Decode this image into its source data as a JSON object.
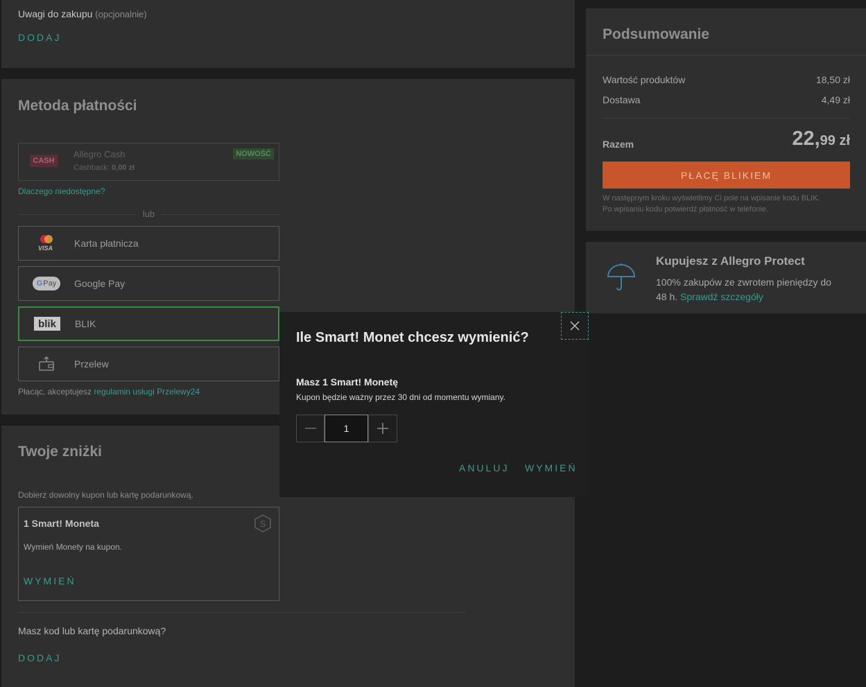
{
  "notes": {
    "title": "Uwagi do zakupu",
    "optional": "(opcjonalnie)",
    "add": "DODAJ"
  },
  "payment": {
    "title": "Metoda płatności",
    "cash": {
      "badge": "CASH",
      "name": "Allegro Cash",
      "cashback_label": "Cashback:",
      "cashback_value": "0,00 zł",
      "new_badge": "NOWOŚĆ"
    },
    "why_unavailable": "Dlaczego niedostępne?",
    "or": "lub",
    "options": [
      {
        "label": "Karta płatnicza",
        "icon": "card-icon"
      },
      {
        "label": "Google Pay",
        "icon": "google-pay-icon"
      },
      {
        "label": "BLIK",
        "icon": "blik-icon"
      },
      {
        "label": "Przelew",
        "icon": "wallet-icon"
      }
    ],
    "visa_text": "VISA",
    "gpay_text": "Pay",
    "blik_text": "blik",
    "terms_prefix": "Płacąc, akceptujesz",
    "terms_link": "regulamin usługi Przelewy24"
  },
  "discounts": {
    "title": "Twoje zniżki",
    "hint": "Dobierz dowolny kupon lub kartę podarunkową.",
    "coin_card": {
      "title": "1 Smart! Moneta",
      "desc": "Wymień Monety na kupon.",
      "action": "WYMIEŃ",
      "icon_letter": "S"
    },
    "code_question": "Masz kod lub kartę podarunkową?",
    "add": "DODAJ"
  },
  "summary": {
    "title": "Podsumowanie",
    "products_label": "Wartość produktów",
    "products_value": "18,50 zł",
    "delivery_label": "Dostawa",
    "delivery_value": "4,49 zł",
    "total_label": "Razem",
    "total_int": "22,",
    "total_dec": "99 zł",
    "pay_button": "PŁACĘ BLIKIEM",
    "note_line1": "W następnym kroku wyświetlimy Ci pole na wpisanie kodu BLIK.",
    "note_line2": "Po wpisaniu kodu potwierdź płatność w telefonie.",
    "accent_color": "#c8562a"
  },
  "protect": {
    "title": "Kupujesz z Allegro Protect",
    "text_line1": "100% zakupów ze zwrotem pieniędzy do",
    "text_line2": "48 h.",
    "link": "Sprawdź szczegóły"
  },
  "modal": {
    "title": "Ile Smart! Monet chcesz wymienić?",
    "subtitle": "Masz 1 Smart! Monetę",
    "info": "Kupon będzie ważny przez 30 dni od momentu wymiany.",
    "quantity": "1",
    "cancel": "ANULUJ",
    "confirm": "WYMIEŃ"
  }
}
